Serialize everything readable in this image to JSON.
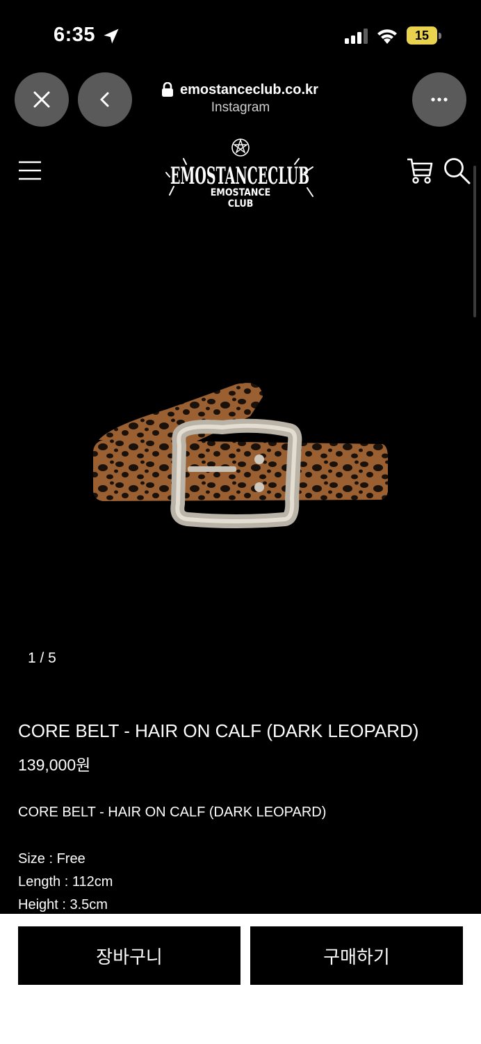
{
  "status_bar": {
    "time": "6:35",
    "battery_level": "15",
    "icons": [
      "location-arrow-icon",
      "cellular-signal-icon",
      "wifi-icon",
      "battery-icon"
    ]
  },
  "browser": {
    "url": "emostanceclub.co.kr",
    "source": "Instagram",
    "icons": [
      "close-icon",
      "chevron-left-icon",
      "lock-icon",
      "more-icon"
    ]
  },
  "site_header": {
    "logo_text": "EMOSTANCE CLUB",
    "icons": [
      "hamburger-menu-icon",
      "cart-icon",
      "search-icon"
    ]
  },
  "product": {
    "image_pager": "1 / 5",
    "title": "CORE BELT - HAIR ON CALF (DARK LEOPARD)",
    "price": "139,000원",
    "description_title": "CORE BELT - HAIR ON CALF (DARK LEOPARD)",
    "specs": [
      "Size : Free",
      "Length : 112cm",
      "Height : 3.5cm"
    ]
  },
  "actions": {
    "cart_label": "장바구니",
    "buy_label": "구매하기"
  },
  "colors": {
    "background": "#000000",
    "browser_button": "#5a5a5a",
    "battery": "#e9d24e",
    "bottom_bar": "#ffffff"
  }
}
